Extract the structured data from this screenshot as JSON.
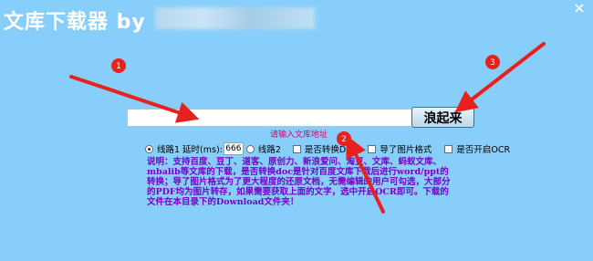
{
  "app": {
    "title": "文库下载器 by"
  },
  "form": {
    "url_value": "",
    "hint": "请输入文库地址",
    "go_label": "浪起来"
  },
  "options": {
    "route1_label": "线路1",
    "delay_label": "延时(ms):",
    "delay_value": "666",
    "route2_label": "线路2",
    "doc_label": "是否转换DOC",
    "image_format_label": "导了图片格式",
    "ocr_label": "是否开启OCR"
  },
  "description": "说明：支持百度、豆丁、道客、原创力、新浪爱问、淘豆、文库、蚂蚁文库、mbalib等文库的下载，是否转换doc是针对百度文库下载后进行word/ppt的转换；导了图片格式为了更大程度的还原文档，无需编辑的用户可勾选，大部分的PDF均为图片转存，如果需要获取上面的文字，选中开启OCR即可。下载的文件在本目录下的Download文件夹！",
  "annotations": {
    "badges": [
      "1",
      "2",
      "3"
    ],
    "color": "#e8211e"
  },
  "colors": {
    "background": "#87CEFA",
    "hint": "#e0006a",
    "description": "#7a00c8",
    "arrow": "#e8211e"
  }
}
